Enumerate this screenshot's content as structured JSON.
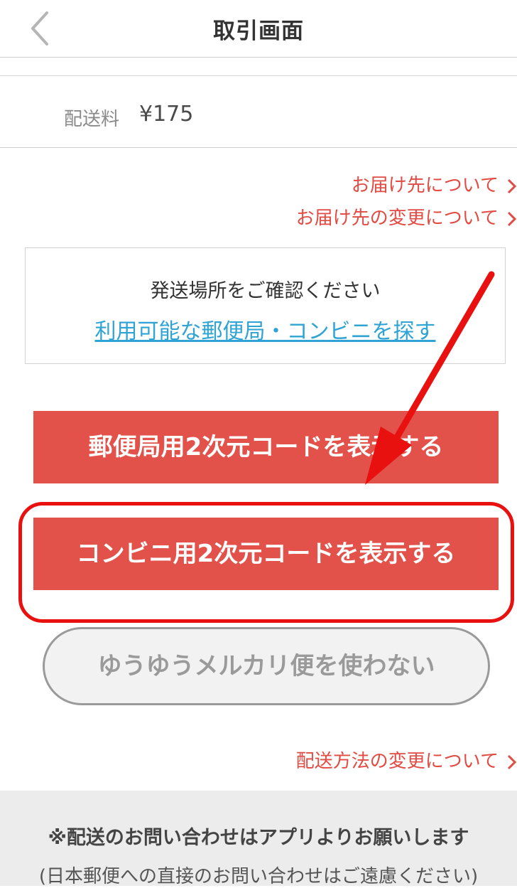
{
  "header": {
    "title": "取引画面",
    "back_icon": "chevron-left-icon"
  },
  "shipping_fee": {
    "label": "配送料",
    "value": "¥175"
  },
  "links": {
    "address": "お届け先について",
    "address_change": "お届け先の変更について",
    "shipping_method_change": "配送方法の変更について"
  },
  "location_box": {
    "prompt": "発送場所をご確認ください",
    "find_link": "利用可能な郵便局・コンビニを探す"
  },
  "buttons": {
    "post_office_code": "郵便局用2次元コードを表示する",
    "konbini_code": "コンビニ用2次元コードを表示する",
    "dont_use": "ゆうゆうメルカリ便を使わない"
  },
  "footer": {
    "notice": "※配送のお問い合わせはアプリよりお願いします",
    "sub_notice": "(日本郵便への直接のお問い合わせはご遠慮ください)"
  },
  "colors": {
    "accent_red": "#e2524a",
    "link_red": "#e24b43",
    "link_blue": "#2ea3d4",
    "annotation_red": "#e8110f"
  }
}
